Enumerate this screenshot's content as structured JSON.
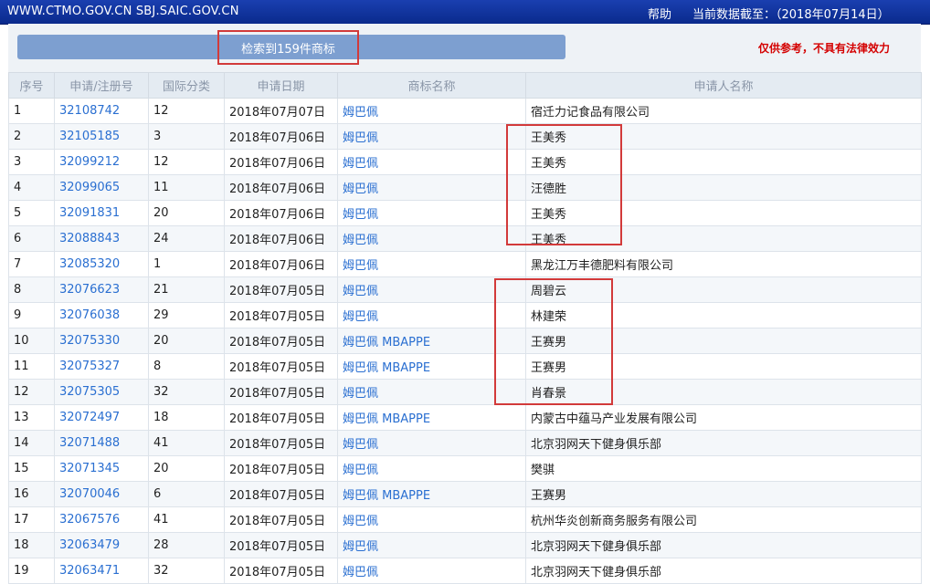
{
  "header": {
    "site": "WWW.CTMO.GOV.CN SBJ.SAIC.GOV.CN",
    "help": "帮助",
    "as_of": "当前数据截至：（2018年07月14日）"
  },
  "search": {
    "result_count": "检索到159件商标",
    "disclaimer": "仅供参考，不具有法律效力"
  },
  "table": {
    "headers": [
      "序号",
      "申请/注册号",
      "国际分类",
      "申请日期",
      "商标名称",
      "申请人名称"
    ],
    "rows": [
      {
        "no": "1",
        "reg": "32108742",
        "cls": "12",
        "date": "2018年07月07日",
        "mark": "姆巴佩",
        "applicant": "宿迁力记食品有限公司"
      },
      {
        "no": "2",
        "reg": "32105185",
        "cls": "3",
        "date": "2018年07月06日",
        "mark": "姆巴佩",
        "applicant": "王美秀"
      },
      {
        "no": "3",
        "reg": "32099212",
        "cls": "12",
        "date": "2018年07月06日",
        "mark": "姆巴佩",
        "applicant": "王美秀"
      },
      {
        "no": "4",
        "reg": "32099065",
        "cls": "11",
        "date": "2018年07月06日",
        "mark": "姆巴佩",
        "applicant": "汪德胜"
      },
      {
        "no": "5",
        "reg": "32091831",
        "cls": "20",
        "date": "2018年07月06日",
        "mark": "姆巴佩",
        "applicant": "王美秀"
      },
      {
        "no": "6",
        "reg": "32088843",
        "cls": "24",
        "date": "2018年07月06日",
        "mark": "姆巴佩",
        "applicant": "王美秀"
      },
      {
        "no": "7",
        "reg": "32085320",
        "cls": "1",
        "date": "2018年07月06日",
        "mark": "姆巴佩",
        "applicant": "黑龙江万丰德肥料有限公司"
      },
      {
        "no": "8",
        "reg": "32076623",
        "cls": "21",
        "date": "2018年07月05日",
        "mark": "姆巴佩",
        "applicant": "周碧云"
      },
      {
        "no": "9",
        "reg": "32076038",
        "cls": "29",
        "date": "2018年07月05日",
        "mark": "姆巴佩",
        "applicant": "林建荣"
      },
      {
        "no": "10",
        "reg": "32075330",
        "cls": "20",
        "date": "2018年07月05日",
        "mark": "姆巴佩 MBAPPE",
        "applicant": "王赛男"
      },
      {
        "no": "11",
        "reg": "32075327",
        "cls": "8",
        "date": "2018年07月05日",
        "mark": "姆巴佩 MBAPPE",
        "applicant": "王赛男"
      },
      {
        "no": "12",
        "reg": "32075305",
        "cls": "32",
        "date": "2018年07月05日",
        "mark": "姆巴佩",
        "applicant": "肖春景"
      },
      {
        "no": "13",
        "reg": "32072497",
        "cls": "18",
        "date": "2018年07月05日",
        "mark": "姆巴佩 MBAPPE",
        "applicant": "内蒙古中蕴马产业发展有限公司"
      },
      {
        "no": "14",
        "reg": "32071488",
        "cls": "41",
        "date": "2018年07月05日",
        "mark": "姆巴佩",
        "applicant": "北京羽网天下健身俱乐部"
      },
      {
        "no": "15",
        "reg": "32071345",
        "cls": "20",
        "date": "2018年07月05日",
        "mark": "姆巴佩",
        "applicant": "樊骐"
      },
      {
        "no": "16",
        "reg": "32070046",
        "cls": "6",
        "date": "2018年07月05日",
        "mark": "姆巴佩 MBAPPE",
        "applicant": "王赛男"
      },
      {
        "no": "17",
        "reg": "32067576",
        "cls": "41",
        "date": "2018年07月05日",
        "mark": "姆巴佩",
        "applicant": "杭州华炎创新商务服务有限公司"
      },
      {
        "no": "18",
        "reg": "32063479",
        "cls": "28",
        "date": "2018年07月05日",
        "mark": "姆巴佩",
        "applicant": "北京羽网天下健身俱乐部"
      },
      {
        "no": "19",
        "reg": "32063471",
        "cls": "32",
        "date": "2018年07月05日",
        "mark": "姆巴佩",
        "applicant": "北京羽网天下健身俱乐部"
      }
    ]
  },
  "colors": {
    "header_bar": "#0a2a8c",
    "link": "#2a6fd1",
    "highlight": "#d23a3a",
    "disclaimer": "#d40000"
  }
}
